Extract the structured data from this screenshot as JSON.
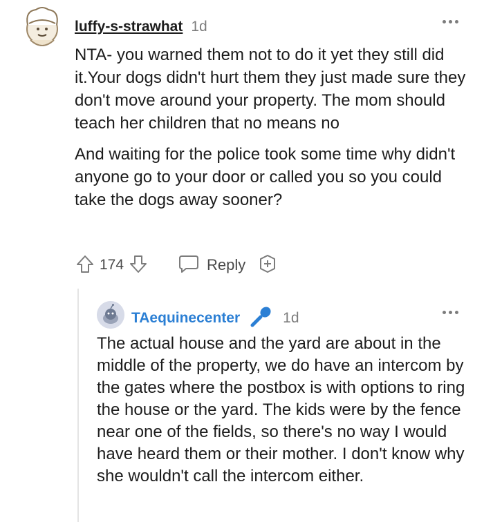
{
  "comment": {
    "username": "luffy-s-strawhat",
    "time": "1d",
    "paragraphs": [
      "NTA- you warned them not to do it yet they still did it.Your dogs didn't hurt them they just made sure they don't move around your property. The mom should teach her children that no means no",
      "And waiting for the police took some time why didn't anyone go to your door or called you so you could take the dogs away sooner?"
    ],
    "vote_count": "174",
    "reply_label": "Reply"
  },
  "reply": {
    "username": "TAequinecenter",
    "time": "1d",
    "body": "The actual house and the yard are about in the middle of the property, we do have an intercom by the gates where the postbox is with options to ring the house or the yard. The kids were by the fence near one of the fields, so there's no way I would have heard them or their mother. I don't know why she wouldn't call the intercom either."
  },
  "colors": {
    "reply_username": "#2b7fd4",
    "mod_icon": "#2b7fd4",
    "meta_gray": "#7c7c7c"
  }
}
